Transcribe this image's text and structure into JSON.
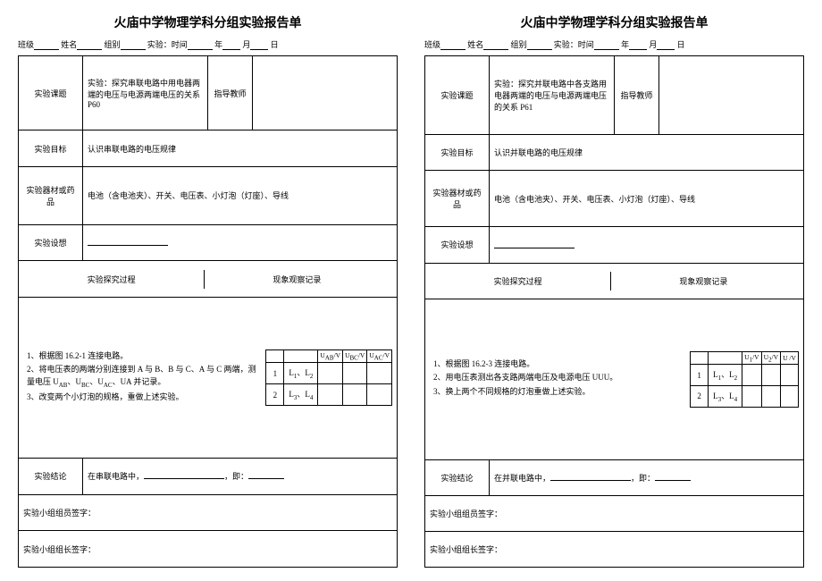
{
  "sheets": [
    {
      "title": "火庙中学物理学科分组实验报告单",
      "header": {
        "class": "班级",
        "name": "姓名",
        "group": "组别",
        "time_prefix": "实验：时间",
        "y": "年",
        "m": "月",
        "d": "日"
      },
      "rows": {
        "topic_label": "实验课题",
        "topic_value": "实验：探究串联电路中用电器两端的电压与电源两端电压的关系 P60",
        "teacher_label": "指导教师",
        "goal_label": "实验目标",
        "goal_value": "认识串联电路的电压规律",
        "equip_label": "实验器材或药品",
        "equip_value": "电池（含电池夹）、开关、电压表、小灯泡（灯座）、导线",
        "assume_label": "实验设想",
        "proc_label": "实验探究过程",
        "obs_label": "现象观察记录",
        "concl_label": "实验结论",
        "concl_value_pre": "在串联电路中，",
        "concl_value_mid": "，即：",
        "sign_member": "实验小组组员签字：",
        "sign_leader": "实验小组组长签字："
      },
      "proc_items": [
        "1、根据图 16.2-1 连接电路。",
        "2、将电压表的两端分别连接到 A 与 B、B 与 C、A 与 C 两端，测量电压 U<sub>AB</sub>、U<sub>BC</sub>、U<sub>AC</sub>、UA 并记录。",
        "3、改变两个小灯泡的规格，重做上述实验。"
      ],
      "obs_headers": [
        "",
        "",
        "U<sub>AB</sub>/V",
        "U<sub>BC</sub>/V",
        "U<sub>AC</sub>/V"
      ],
      "obs_rows": [
        [
          "1",
          "L<sub>1</sub>、L<sub>2</sub>",
          "",
          "",
          ""
        ],
        [
          "2",
          "L<sub>3</sub>、L<sub>4</sub>",
          "",
          "",
          ""
        ]
      ]
    },
    {
      "title": "火庙中学物理学科分组实验报告单",
      "header": {
        "class": "班级",
        "name": "姓名",
        "group": "组别",
        "time_prefix": "实验：时间",
        "y": "年",
        "m": "月",
        "d": "日"
      },
      "rows": {
        "topic_label": "实验课题",
        "topic_value": "实验：探究并联电路中各支路用电器两端的电压与电源两端电压的关系 P61",
        "teacher_label": "指导教师",
        "goal_label": "实验目标",
        "goal_value": "认识并联电路的电压规律",
        "equip_label": "实验器材或药品",
        "equip_value": "电池（含电池夹）、开关、电压表、小灯泡（灯座）、导线",
        "assume_label": "实验设想",
        "proc_label": "实验探究过程",
        "obs_label": "现象观察记录",
        "concl_label": "实验结论",
        "concl_value_pre": "在并联电路中，",
        "concl_value_mid": "，即：",
        "sign_member": "实验小组组员签字：",
        "sign_leader": "实验小组组长签字："
      },
      "proc_items": [
        "1、根据图 16.2-3 连接电路。",
        "2、用电压表测出各支路两端电压及电源电压 UUU。",
        "3、换上两个不同规格的灯泡重做上述实验。"
      ],
      "obs_headers": [
        "",
        "",
        "U<sub>1</sub>/V",
        "U<sub>2</sub>/V",
        "U /V"
      ],
      "obs_rows": [
        [
          "1",
          "L<sub>1</sub>、L<sub>2</sub>",
          "",
          "",
          ""
        ],
        [
          "2",
          "L<sub>3</sub>、L<sub>4</sub>",
          "",
          "",
          ""
        ]
      ]
    }
  ]
}
